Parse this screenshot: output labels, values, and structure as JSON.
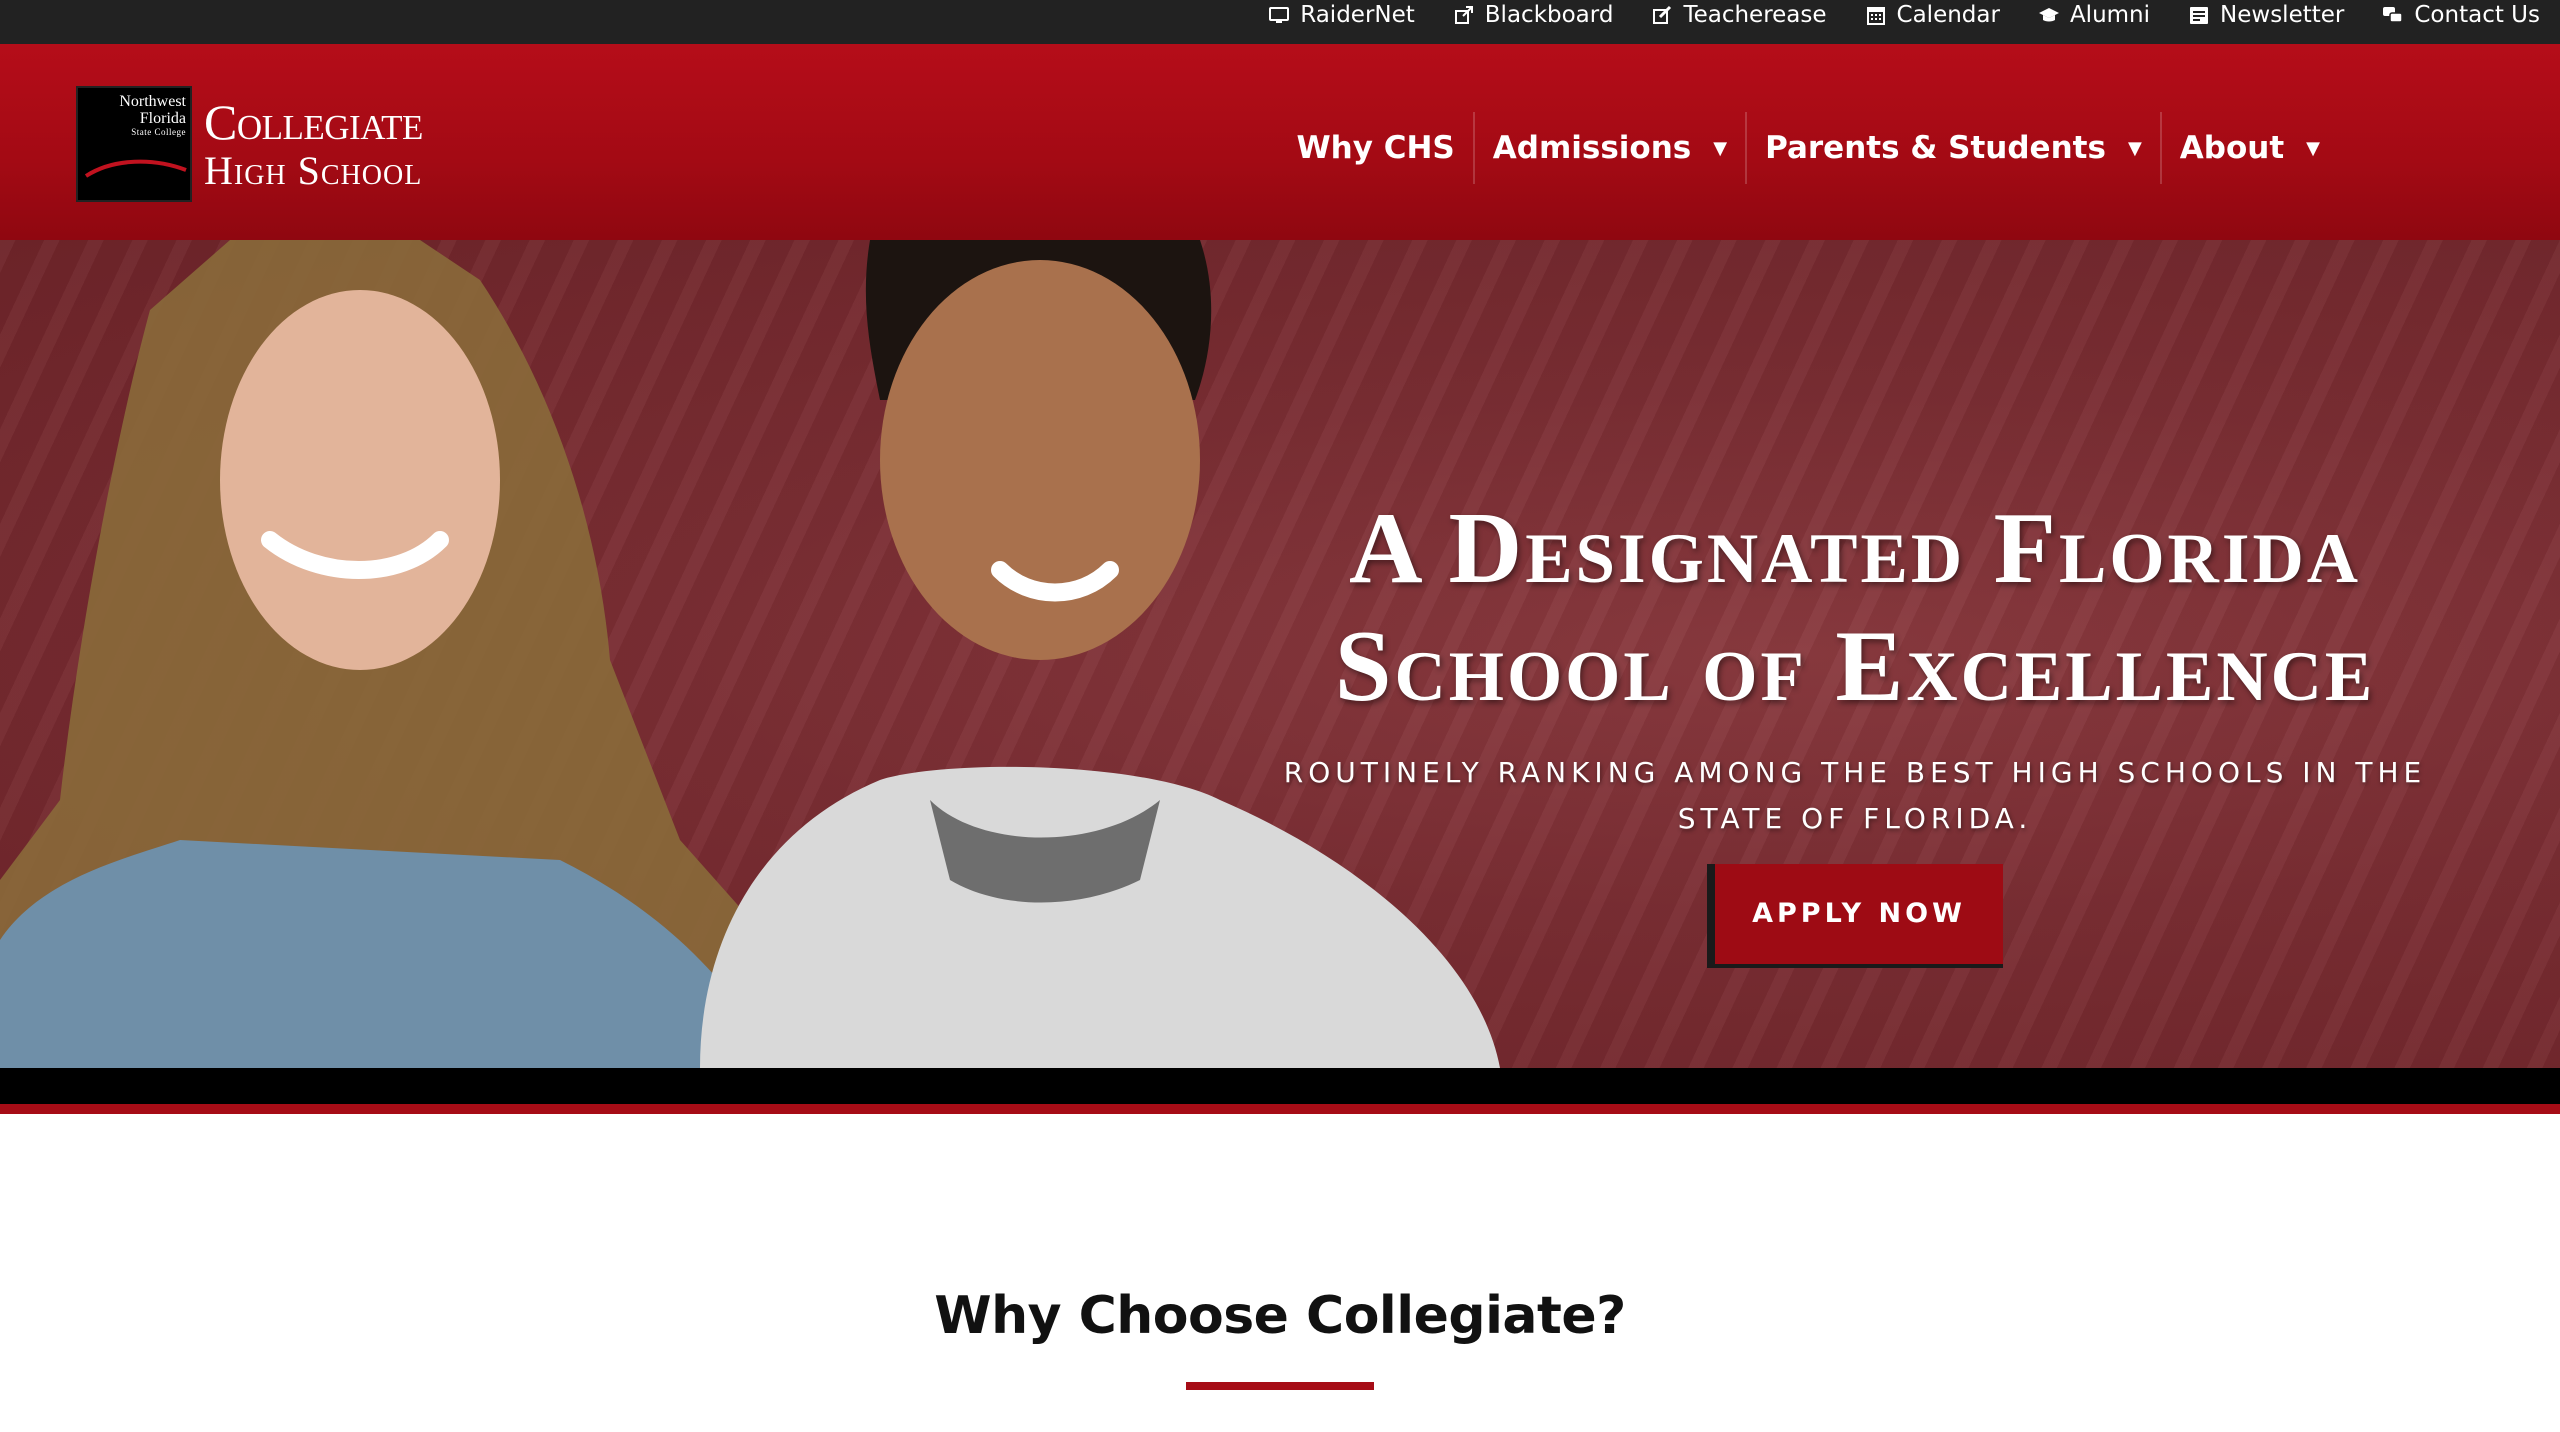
{
  "utility_nav": [
    {
      "label": "RaiderNet",
      "icon": "monitor-icon"
    },
    {
      "label": "Blackboard",
      "icon": "external-link-icon"
    },
    {
      "label": "Teacherease",
      "icon": "edit-icon"
    },
    {
      "label": "Calendar",
      "icon": "calendar-icon"
    },
    {
      "label": "Alumni",
      "icon": "graduation-cap-icon"
    },
    {
      "label": "Newsletter",
      "icon": "newsletter-icon"
    },
    {
      "label": "Contact Us",
      "icon": "chat-bubbles-icon"
    }
  ],
  "logo": {
    "seal_line1": "Northwest",
    "seal_line2": "Florida",
    "seal_line3": "State College",
    "word1": "Collegiate",
    "word2": "High School"
  },
  "main_nav": [
    {
      "label": "Why CHS",
      "has_dropdown": false
    },
    {
      "label": "Admissions",
      "has_dropdown": true
    },
    {
      "label": "Parents & Students",
      "has_dropdown": true
    },
    {
      "label": "About",
      "has_dropdown": true
    }
  ],
  "hero": {
    "title_line1": "A Designated Florida",
    "title_line2": "School of Excellence",
    "subtitle": "Routinely ranking among the best high schools in the state of Florida.",
    "cta_label": "Apply Now"
  },
  "section": {
    "title": "Why Choose Collegiate?"
  },
  "colors": {
    "brand_red": "#a60c16",
    "utility_bar": "#222222",
    "hero_bg": "#7a2d33"
  }
}
